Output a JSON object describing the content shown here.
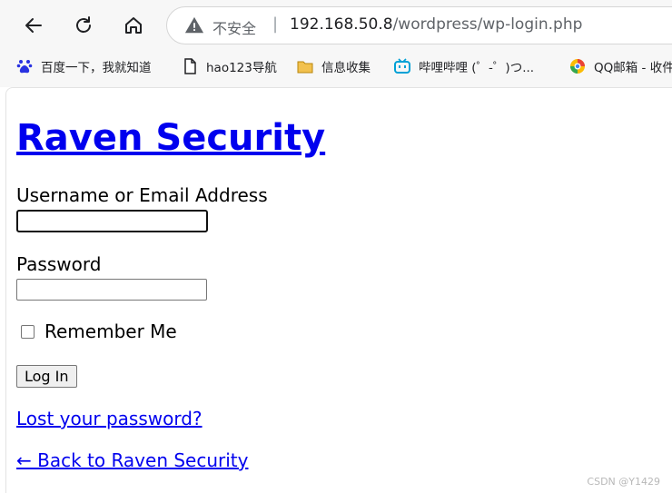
{
  "browser": {
    "security_label": "不安全",
    "url_host": "192.168.50.8",
    "url_path": "/wordpress/wp-login.php",
    "bookmarks": [
      {
        "label": "百度一下，我就知道",
        "icon": "baidu-paw-icon"
      },
      {
        "label": "hao123导航",
        "icon": "page-icon"
      },
      {
        "label": "信息收集",
        "icon": "folder-icon"
      },
      {
        "label": "哔哩哔哩 (゜-゜)つ...",
        "icon": "bilibili-icon"
      },
      {
        "label": "QQ邮箱 - 收件",
        "icon": "qq-mail-icon"
      }
    ]
  },
  "login": {
    "site_title": "Raven Security",
    "username_label": "Username or Email Address",
    "username_value": "",
    "password_label": "Password",
    "password_value": "",
    "remember_label": "Remember Me",
    "remember_checked": false,
    "submit_label": "Log In",
    "lost_password": "Lost your password?",
    "back_link": "← Back to Raven Security"
  },
  "watermark": "CSDN @Y1429",
  "colors": {
    "link": "#0000ee",
    "chrome_bg": "#f7f7f7",
    "warning": "#5f6368",
    "folder": "#f2c14e",
    "bilibili": "#00a1d6"
  }
}
